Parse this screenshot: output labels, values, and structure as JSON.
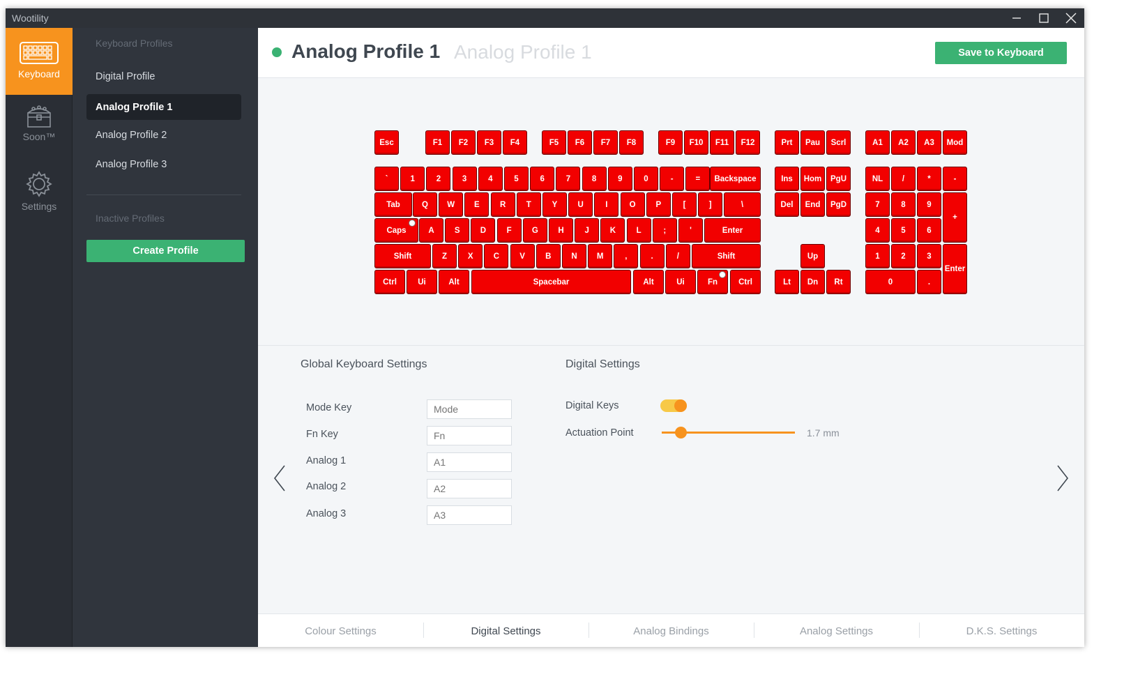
{
  "window": {
    "title": "Wootility"
  },
  "rail": {
    "items": [
      {
        "label": "Keyboard",
        "icon": "keyboard-icon",
        "active": true
      },
      {
        "label": "Soon™",
        "icon": "treasure-chest-icon",
        "active": false
      },
      {
        "label": "Settings",
        "icon": "gear-icon",
        "active": false
      }
    ]
  },
  "profiles": {
    "header": "Keyboard Profiles",
    "items": [
      "Digital Profile",
      "Analog Profile 1",
      "Analog Profile 2",
      "Analog Profile 3"
    ],
    "active": "Analog Profile 1",
    "inactive_header": "Inactive Profiles",
    "create_label": "Create Profile"
  },
  "header": {
    "title": "Analog Profile 1",
    "subtitle": "Analog Profile 1",
    "status_color": "#3bb273",
    "save_label": "Save to Keyboard"
  },
  "keyboard": {
    "key_color": "#f20000",
    "row_fn": [
      "Esc",
      "F1",
      "F2",
      "F3",
      "F4",
      "F5",
      "F6",
      "F7",
      "F8",
      "F9",
      "F10",
      "F11",
      "F12",
      "Prt",
      "Pau",
      "Scrl",
      "A1",
      "A2",
      "A3",
      "Mod"
    ],
    "row_num": [
      "`",
      "1",
      "2",
      "3",
      "4",
      "5",
      "6",
      "7",
      "8",
      "9",
      "0",
      "-",
      "=",
      "Backspace",
      "Ins",
      "Hom",
      "PgU",
      "NL",
      "/",
      "*",
      "-"
    ],
    "row_tab": [
      "Tab",
      "Q",
      "W",
      "E",
      "R",
      "T",
      "Y",
      "U",
      "I",
      "O",
      "P",
      "[",
      "]",
      "\\",
      "Del",
      "End",
      "PgD",
      "7",
      "8",
      "9",
      "+"
    ],
    "row_caps": [
      "Caps",
      "A",
      "S",
      "D",
      "F",
      "G",
      "H",
      "J",
      "K",
      "L",
      ";",
      "'",
      "Enter",
      "4",
      "5",
      "6"
    ],
    "row_shift": [
      "Shift",
      "Z",
      "X",
      "C",
      "V",
      "B",
      "N",
      "M",
      ",",
      ".",
      "/",
      "Shift",
      "Up",
      "1",
      "2",
      "3",
      "Enter"
    ],
    "row_bottom": [
      "Ctrl",
      "Ui",
      "Alt",
      "Spacebar",
      "Alt",
      "Ui",
      "Fn",
      "Ctrl",
      "Lt",
      "Dn",
      "Rt",
      "0",
      "."
    ]
  },
  "global_settings": {
    "title": "Global Keyboard Settings",
    "fields": [
      {
        "label": "Mode Key",
        "placeholder": "Mode"
      },
      {
        "label": "Fn Key",
        "placeholder": "Fn"
      },
      {
        "label": "Analog 1",
        "placeholder": "A1"
      },
      {
        "label": "Analog 2",
        "placeholder": "A2"
      },
      {
        "label": "Analog 3",
        "placeholder": "A3"
      }
    ]
  },
  "digital_settings": {
    "title": "Digital Settings",
    "digital_keys_label": "Digital Keys",
    "digital_keys_on": true,
    "actuation_label": "Actuation Point",
    "actuation_value": "1.7 mm",
    "actuation_mm": 1.7,
    "accent_color": "#f7931e"
  },
  "tabs": {
    "items": [
      "Colour Settings",
      "Digital Settings",
      "Analog Bindings",
      "Analog Settings",
      "D.K.S. Settings"
    ],
    "active": "Digital Settings"
  }
}
